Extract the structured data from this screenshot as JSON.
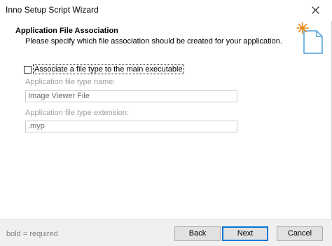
{
  "window": {
    "title": "Inno Setup Script Wizard"
  },
  "header": {
    "title": "Application File Association",
    "subtitle": "Please specify which file association should be created for your application."
  },
  "checkbox": {
    "label": "Associate a file type to the main executable",
    "checked": false
  },
  "fields": {
    "type_name_label": "Application file type name:",
    "type_name_value": "Image Viewer File",
    "extension_label": "Application file type extension:",
    "extension_value": ".myp"
  },
  "footer": {
    "legend": "bold = required",
    "back_label": "Back",
    "next_label": "Next",
    "cancel_label": "Cancel"
  },
  "icons": {
    "close": "close-icon",
    "wizard": "wizard-document-icon"
  },
  "colors": {
    "accent": "#0078d7",
    "disabled_text": "#a0a0a0",
    "wizard_spark": "#e8891c",
    "wizard_doc": "#4a9fd8"
  }
}
